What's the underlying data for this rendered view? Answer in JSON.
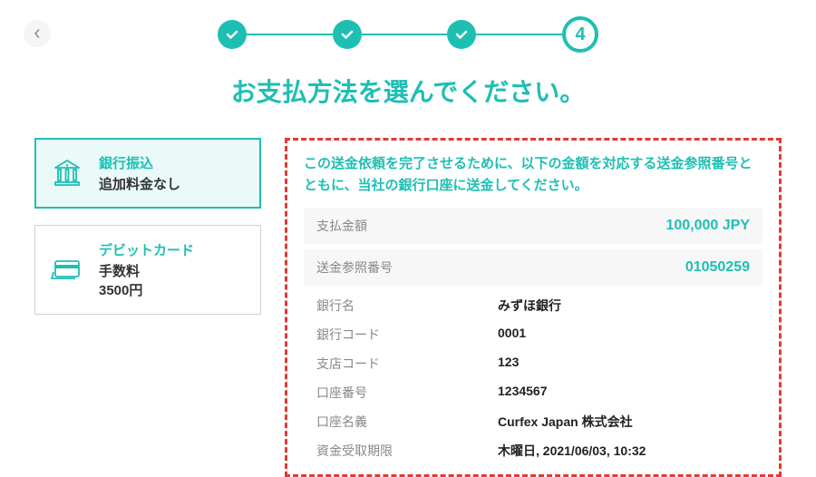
{
  "stepper": {
    "current": "4"
  },
  "page_title": "お支払方法を選んでください。",
  "options": {
    "bank": {
      "label": "銀行振込",
      "sub": "追加料金なし"
    },
    "debit": {
      "label": "デビットカード",
      "sub1": "手数料",
      "sub2": "3500円"
    }
  },
  "details": {
    "instruction": "この送金依頼を完了させるために、以下の金額を対応する送金参照番号とともに、当社の銀行口座に送金してください。",
    "amount_label": "支払金額",
    "amount_value": "100,000 JPY",
    "ref_label": "送金参照番号",
    "ref_value": "01050259",
    "rows": {
      "bank_name": {
        "label": "銀行名",
        "value": "みずほ銀行"
      },
      "bank_code": {
        "label": "銀行コード",
        "value": "0001"
      },
      "branch_code": {
        "label": "支店コード",
        "value": "123"
      },
      "account_no": {
        "label": "口座番号",
        "value": "1234567"
      },
      "account_name": {
        "label": "口座名義",
        "value": "Curfex Japan 株式会社"
      },
      "deadline": {
        "label": "資金受取期限",
        "value": "木曜日, 2021/06/03, 10:32"
      }
    }
  }
}
